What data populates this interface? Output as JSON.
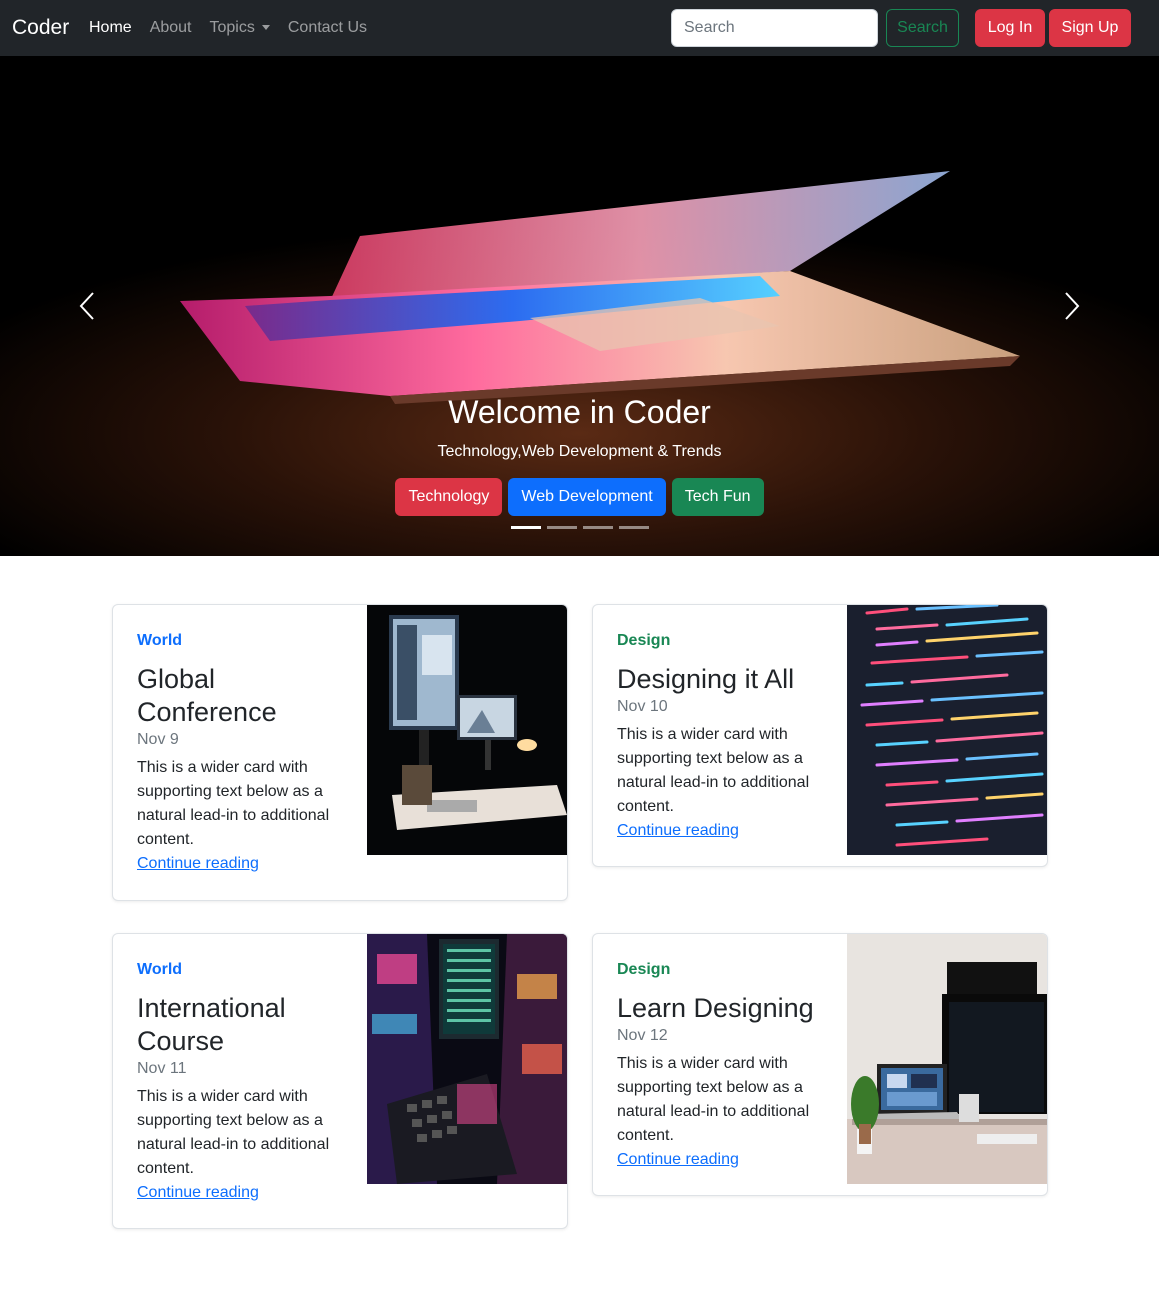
{
  "navbar": {
    "brand": "Coder",
    "links": [
      {
        "label": "Home",
        "active": true
      },
      {
        "label": "About",
        "active": false
      },
      {
        "label": "Topics",
        "active": false,
        "dropdown": true
      },
      {
        "label": "Contact Us",
        "active": false
      }
    ],
    "search_placeholder": "Search",
    "search_button": "Search",
    "login_button": "Log In",
    "signup_button": "Sign Up"
  },
  "carousel": {
    "title": "Welcome in Coder",
    "subtitle": "Technology,Web Development & Trends",
    "buttons": [
      {
        "label": "Technology",
        "color": "#dc3545"
      },
      {
        "label": "Web Development",
        "color": "#0d6efd"
      },
      {
        "label": "Tech Fun",
        "color": "#198754"
      }
    ],
    "slide_count": 4,
    "active_slide": 1
  },
  "cards": [
    {
      "category": "World",
      "category_color": "#0d6efd",
      "title": "Global Conference",
      "date": "Nov 9",
      "text": "This is a wider card with supporting text below as a natural lead-in to additional content.",
      "link": "Continue reading",
      "image": "monitor-desk-icon"
    },
    {
      "category": "Design",
      "category_color": "#198754",
      "title": "Designing it All",
      "date": "Nov 10",
      "text": "This is a wider card with supporting text below as a natural lead-in to additional content.",
      "link": "Continue reading",
      "image": "code-screen-icon"
    },
    {
      "category": "World",
      "category_color": "#0d6efd",
      "title": "International Course",
      "date": "Nov 11",
      "text": "This is a wider card with supporting text below as a natural lead-in to additional content.",
      "link": "Continue reading",
      "image": "cyber-city-icon"
    },
    {
      "category": "Design",
      "category_color": "#198754",
      "title": "Learn Designing",
      "date": "Nov 12",
      "text": "This is a wider card with supporting text below as a natural lead-in to additional content.",
      "link": "Continue reading",
      "image": "workspace-icon"
    }
  ]
}
